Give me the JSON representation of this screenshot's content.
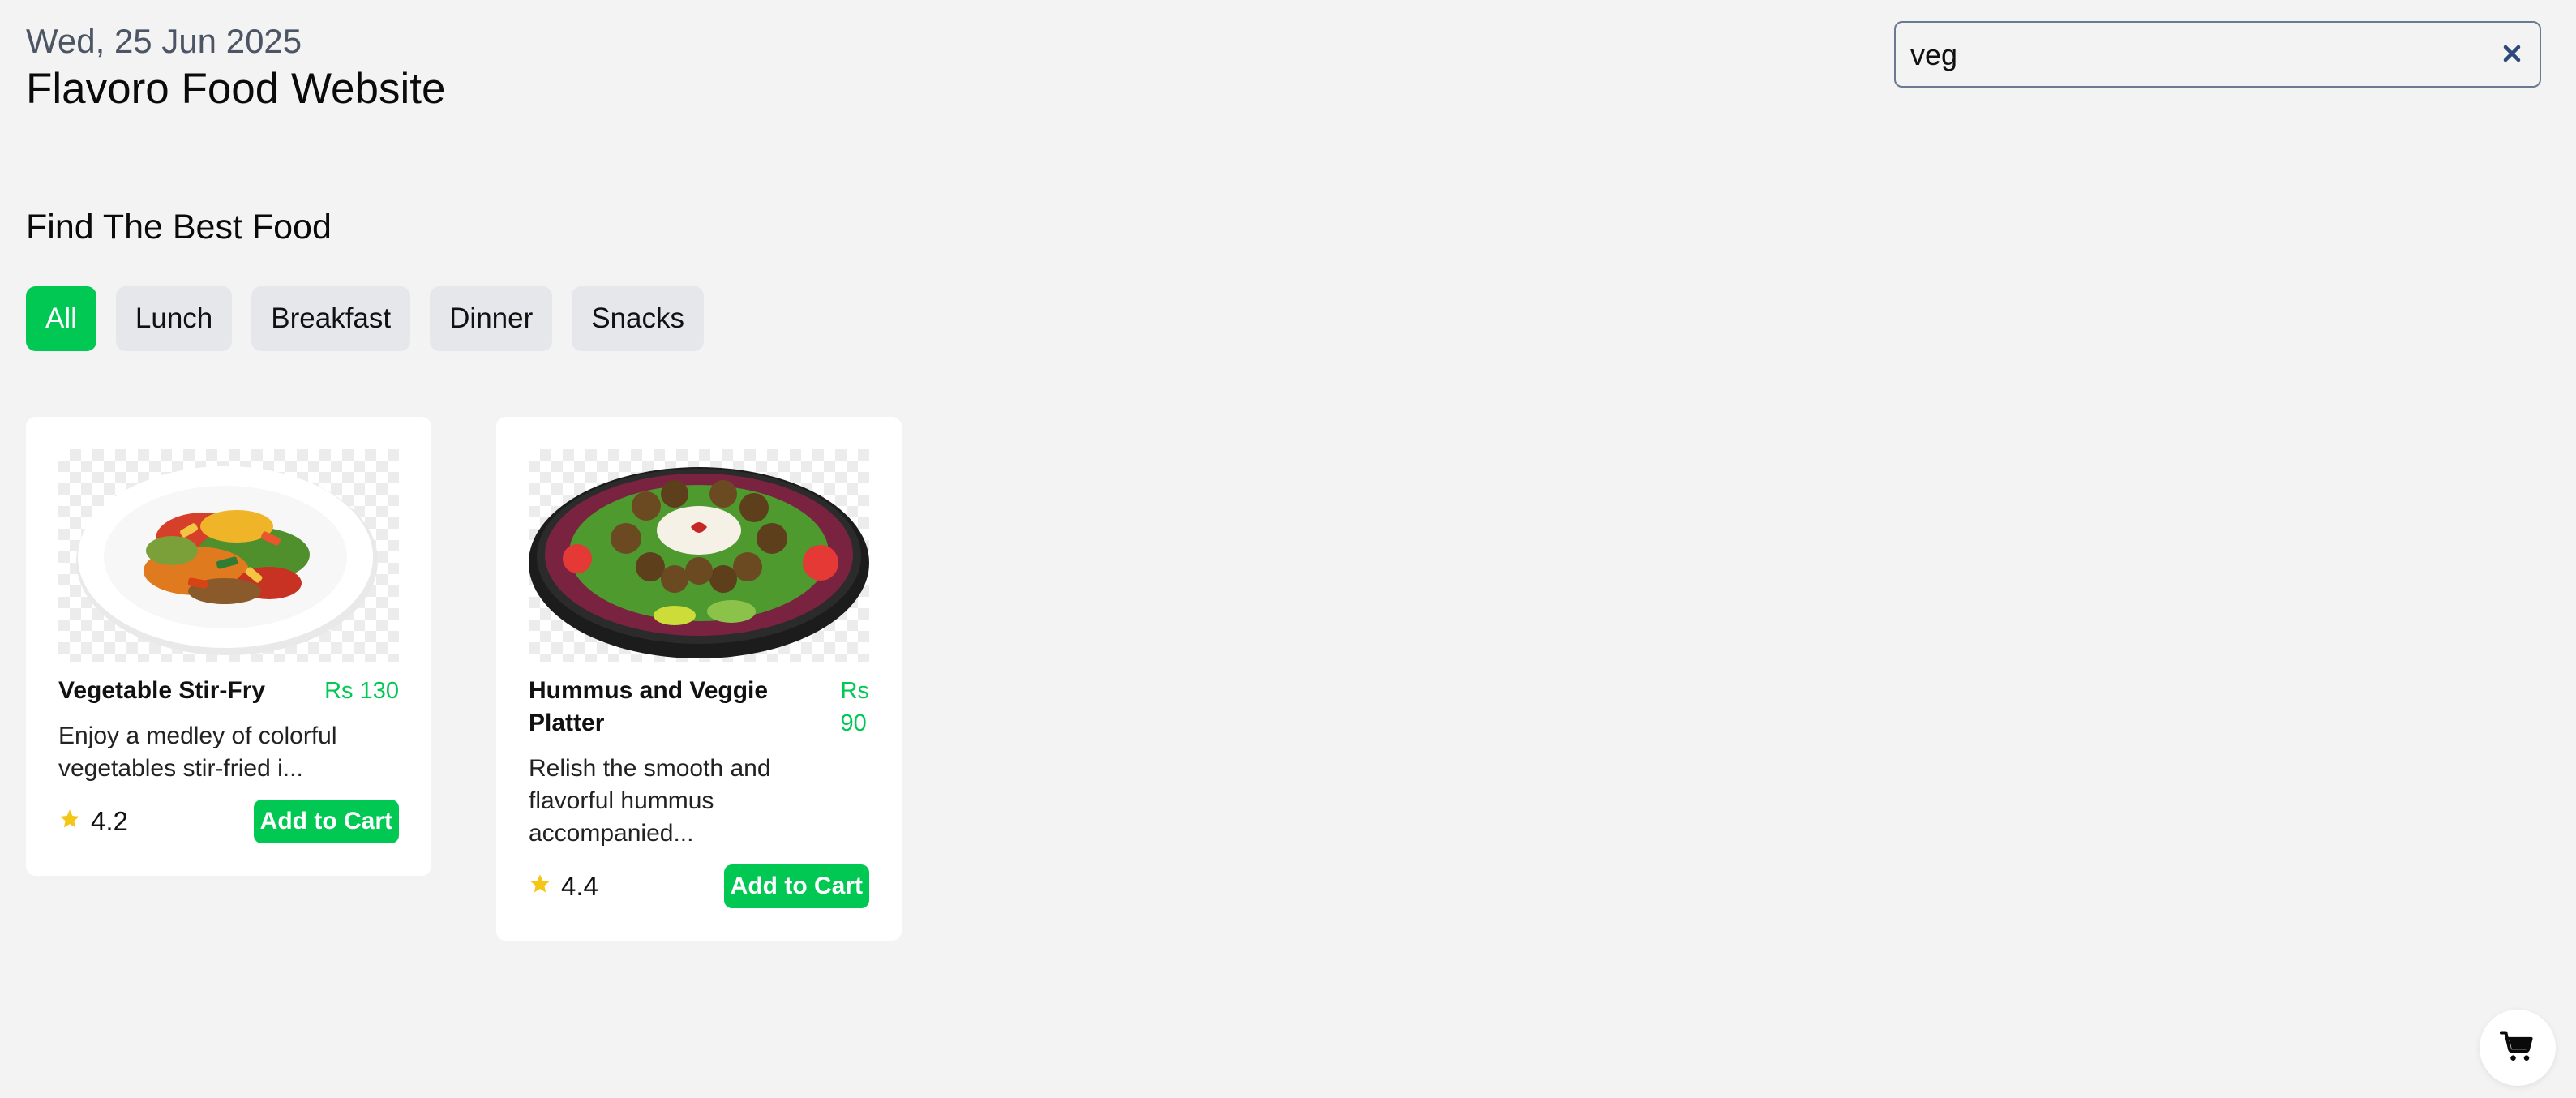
{
  "header": {
    "date": "Wed, 25 Jun 2025",
    "title": "Flavoro Food Website"
  },
  "search": {
    "value": "veg",
    "clear_icon": "close-icon"
  },
  "section": {
    "title": "Find The Best Food"
  },
  "filters": [
    {
      "label": "All",
      "active": true
    },
    {
      "label": "Lunch",
      "active": false
    },
    {
      "label": "Breakfast",
      "active": false
    },
    {
      "label": "Dinner",
      "active": false
    },
    {
      "label": "Snacks",
      "active": false
    }
  ],
  "foods": [
    {
      "name": "Vegetable Stir-Fry",
      "price": "Rs 130",
      "description": "Enjoy a medley of colorful vegetables stir-fried i...",
      "rating": "4.2",
      "button": "Add to Cart",
      "image": "vegetable-stir-fry-image"
    },
    {
      "name": "Hummus and Veggie Platter",
      "price_line1": "Rs",
      "price_line2": "90",
      "description": "Relish the smooth and flavorful hummus accompanied...",
      "rating": "4.4",
      "button": "Add to Cart",
      "image": "hummus-veggie-platter-image"
    }
  ],
  "cart": {
    "icon": "shopping-cart-icon"
  },
  "colors": {
    "accent": "#00c853",
    "background": "#f3f3f3",
    "chip": "#e5e7eb",
    "star": "#f5c518"
  }
}
